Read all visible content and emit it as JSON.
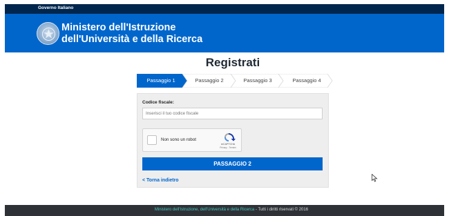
{
  "gov_bar": {
    "label": "Governo Italiano"
  },
  "header": {
    "ministry_line1": "Ministero dell'Istruzione",
    "ministry_line2": "dell'Università e della Ricerca"
  },
  "page": {
    "title": "Registrati"
  },
  "steps": [
    {
      "label": "Passaggio 1",
      "active": true
    },
    {
      "label": "Passaggio 2",
      "active": false
    },
    {
      "label": "Passaggio 3",
      "active": false
    },
    {
      "label": "Passaggio 4",
      "active": false
    }
  ],
  "form": {
    "codice_fiscale_label": "Codice fiscale:",
    "codice_fiscale_placeholder": "Inserisci il tuo codice fiscale",
    "codice_fiscale_value": "",
    "captcha_label": "Non sono un robot",
    "captcha_brand": "reCAPTCHA",
    "captcha_privacy": "Privacy - Termini",
    "next_button": "PASSAGGIO 2",
    "back_link": "< Torna indietro"
  },
  "footer": {
    "text_main": "Ministero dell'Istruzione, dell'Università e della Ricerca",
    "text_rest": " - Tutti i diritti riservati © 2016"
  },
  "colors": {
    "gov_bar": "#00264d",
    "primary": "#0066cc",
    "footer_bg": "#2e3237",
    "footer_accent": "#45c6c0",
    "step_active": "#0066cc",
    "step_inactive": "#ffffff"
  },
  "icons": [
    "emblem-icon",
    "captcha-logo-icon",
    "chevron-left-icon",
    "mouse-cursor-icon"
  ]
}
